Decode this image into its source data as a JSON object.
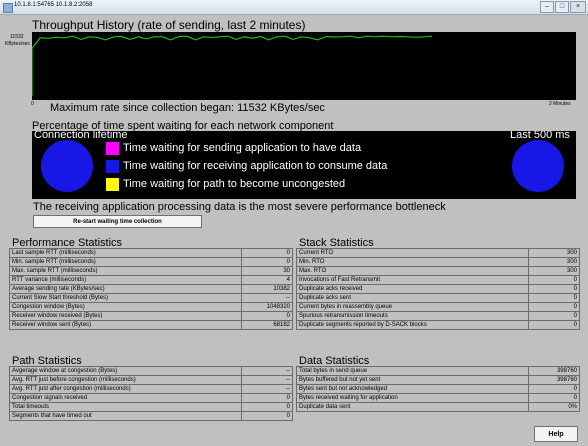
{
  "window": {
    "title": "10.1.8.1:54765 10.1.8.2:2058",
    "controls": {
      "minimize": "–",
      "maximize": "□",
      "close": "×"
    }
  },
  "throughput": {
    "title": "Throughput History (rate of sending, last 2 minutes)",
    "y_max_label": "11532",
    "y_unit_label": "KBytes/sec",
    "x_start_label": "0",
    "x_end_label": "2 Minutes",
    "max_rate_text": "Maximum rate since collection began: 11532 KBytes/sec",
    "line_color": "#1dbf1d"
  },
  "chart_data": {
    "type": "line",
    "title": "Throughput History (rate of sending, last 2 minutes)",
    "xlabel": "",
    "ylabel": "KBytes/sec",
    "xlim": [
      0,
      2
    ],
    "ylim": [
      0,
      11532
    ],
    "series": [
      {
        "values": [
          9000,
          11000,
          10900,
          11100,
          11000,
          11300,
          10700,
          11200,
          11100,
          10600,
          11200,
          11250,
          10700,
          11200,
          10800,
          11200,
          11200,
          10600,
          11250,
          11300,
          10600,
          11200,
          11100,
          11200,
          11300,
          10700,
          11200,
          10900,
          11250,
          10600,
          11200,
          11300,
          10700,
          11200,
          11000,
          10600,
          11250,
          11150,
          11200,
          11300,
          11000,
          11300,
          11200,
          11300,
          11200,
          11250,
          11200,
          11100,
          11200,
          11300
        ]
      }
    ]
  },
  "waiting": {
    "title": "Percentage of time spent waiting for each network component",
    "left_label": "Connection lifetime",
    "right_label": "Last 500 ms",
    "legend": [
      {
        "label": "Time waiting for sending application to have data",
        "color": "#ff00ff"
      },
      {
        "label": "Time waiting for receiving application to consume data",
        "color": "#1717e6"
      },
      {
        "label": "Time waiting for path to become uncongested",
        "color": "#ffff00"
      }
    ],
    "bottleneck_text": "The receiving application processing data is the most severe performance bottleneck",
    "restart_label": "Re-start waiting time collection"
  },
  "performance": {
    "title": "Performance Statistics",
    "rows": [
      {
        "label": "Last sample RTT (milliseconds)",
        "value": "0"
      },
      {
        "label": "Min. sample RTT (milliseconds)",
        "value": "0"
      },
      {
        "label": "Max. sample RTT (milliseconds)",
        "value": "30"
      },
      {
        "label": "RTT variance (milliseconds)",
        "value": "4"
      },
      {
        "label": "Average sending rate (KBytes/sec)",
        "value": "10382"
      },
      {
        "label": "Current Slow Start threshold (Bytes)",
        "value": "--"
      },
      {
        "label": "Congestion window (Bytes)",
        "value": "1048320"
      },
      {
        "label": "Receiver window received (Bytes)",
        "value": "0"
      },
      {
        "label": "Receiver window sent (Bytes)",
        "value": "68182"
      }
    ]
  },
  "stack": {
    "title": "Stack Statistics",
    "rows": [
      {
        "label": "Current RTO",
        "value": "300"
      },
      {
        "label": "Min. RTO",
        "value": "300"
      },
      {
        "label": "Max. RTO",
        "value": "300"
      },
      {
        "label": "Invocations of Fast Retransmit",
        "value": "0"
      },
      {
        "label": "Duplicate acks received",
        "value": "0"
      },
      {
        "label": "Duplicate acks sent",
        "value": "0"
      },
      {
        "label": "Current bytes in reassembly queue",
        "value": "0"
      },
      {
        "label": "Spurious retransmission timeouts",
        "value": "0"
      },
      {
        "label": "Duplicate segments reported by D-SACK blocks",
        "value": "0"
      }
    ]
  },
  "path": {
    "title": "Path Statistics",
    "rows": [
      {
        "label": "Avgerage window at congestion (Bytes)",
        "value": "--"
      },
      {
        "label": "Avg. RTT just before congestion (milliseconds)",
        "value": "--"
      },
      {
        "label": "Avg. RTT just after congestion (milliseconds)",
        "value": "--"
      },
      {
        "label": "Congestion signals received",
        "value": "0"
      },
      {
        "label": "Total timeouts",
        "value": "0"
      },
      {
        "label": "Segments that have timed out",
        "value": "0"
      }
    ]
  },
  "datastats": {
    "title": "Data Statistics",
    "rows": [
      {
        "label": "Total bytes in send queue",
        "value": "398760"
      },
      {
        "label": "Bytes buffered but not yet sent",
        "value": "398760"
      },
      {
        "label": "Bytes sent but not acknowledged",
        "value": "0"
      },
      {
        "label": "Bytes received waiting for application",
        "value": "0"
      },
      {
        "label": "Duplicate data sent",
        "value": "0%"
      }
    ]
  },
  "help_label": "Help"
}
